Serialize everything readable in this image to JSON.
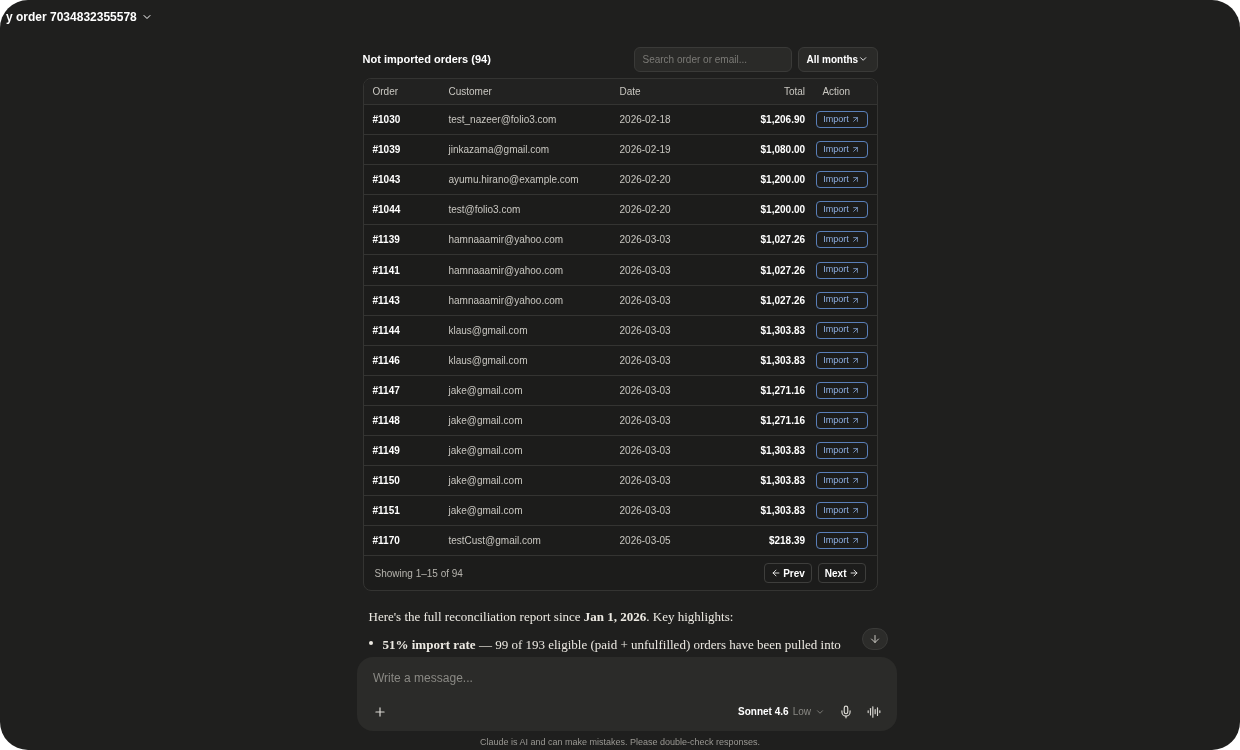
{
  "header": {
    "title": "y order 7034832355578"
  },
  "panel": {
    "title": "Not imported orders (94)",
    "search": {
      "placeholder": "Search order or email..."
    },
    "filter": {
      "value": "All months"
    }
  },
  "table": {
    "columns": [
      "Order",
      "Customer",
      "Date",
      "Total",
      "Action"
    ],
    "rows": [
      {
        "order": "#1030",
        "customer": "test_nazeer@folio3.com",
        "date": "2026-02-18",
        "total": "$1,206.90",
        "action": "Import"
      },
      {
        "order": "#1039",
        "customer": "jinkazama@gmail.com",
        "date": "2026-02-19",
        "total": "$1,080.00",
        "action": "Import"
      },
      {
        "order": "#1043",
        "customer": "ayumu.hirano@example.com",
        "date": "2026-02-20",
        "total": "$1,200.00",
        "action": "Import"
      },
      {
        "order": "#1044",
        "customer": "test@folio3.com",
        "date": "2026-02-20",
        "total": "$1,200.00",
        "action": "Import"
      },
      {
        "order": "#1139",
        "customer": "hamnaaamir@yahoo.com",
        "date": "2026-03-03",
        "total": "$1,027.26",
        "action": "Import"
      },
      {
        "order": "#1141",
        "customer": "hamnaaamir@yahoo.com",
        "date": "2026-03-03",
        "total": "$1,027.26",
        "action": "Import"
      },
      {
        "order": "#1143",
        "customer": "hamnaaamir@yahoo.com",
        "date": "2026-03-03",
        "total": "$1,027.26",
        "action": "Import"
      },
      {
        "order": "#1144",
        "customer": "klaus@gmail.com",
        "date": "2026-03-03",
        "total": "$1,303.83",
        "action": "Import"
      },
      {
        "order": "#1146",
        "customer": "klaus@gmail.com",
        "date": "2026-03-03",
        "total": "$1,303.83",
        "action": "Import"
      },
      {
        "order": "#1147",
        "customer": "jake@gmail.com",
        "date": "2026-03-03",
        "total": "$1,271.16",
        "action": "Import"
      },
      {
        "order": "#1148",
        "customer": "jake@gmail.com",
        "date": "2026-03-03",
        "total": "$1,271.16",
        "action": "Import"
      },
      {
        "order": "#1149",
        "customer": "jake@gmail.com",
        "date": "2026-03-03",
        "total": "$1,303.83",
        "action": "Import"
      },
      {
        "order": "#1150",
        "customer": "jake@gmail.com",
        "date": "2026-03-03",
        "total": "$1,303.83",
        "action": "Import"
      },
      {
        "order": "#1151",
        "customer": "jake@gmail.com",
        "date": "2026-03-03",
        "total": "$1,303.83",
        "action": "Import"
      },
      {
        "order": "#1170",
        "customer": "testCust@gmail.com",
        "date": "2026-03-05",
        "total": "$218.39",
        "action": "Import"
      }
    ],
    "footer": {
      "showing": "Showing 1–15 of 94",
      "prev": "Prev",
      "next": "Next"
    }
  },
  "message": {
    "intro": "Here's the full reconciliation report since **Jan 1, 2026**. Key highlights:",
    "bullets": [
      "**51% import rate** — 99 of 193 eligible (paid + unfulfilled) orders have been pulled into"
    ]
  },
  "composer": {
    "placeholder": "Write a message...",
    "model": "Sonnet 4.6",
    "effort": "Low"
  },
  "disclaimer": "Claude is AI and can make mistakes. Please double-check responses."
}
